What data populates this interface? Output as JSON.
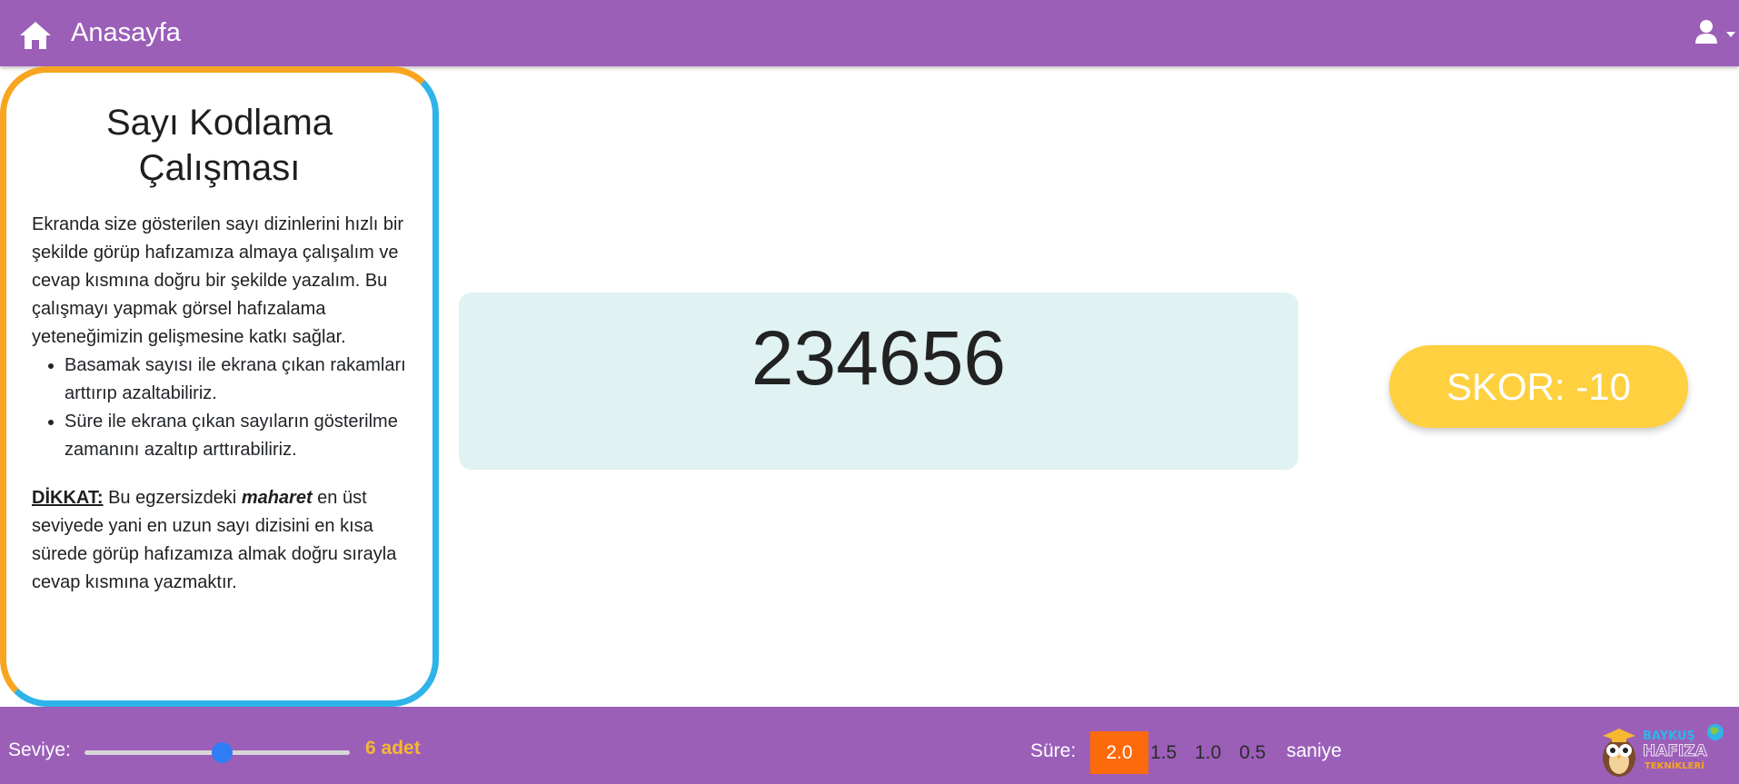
{
  "navbar": {
    "title": "Anasayfa",
    "home_icon": "home-icon",
    "user_icon": "user-icon",
    "background": "#9b5fb8"
  },
  "info": {
    "title_line1": "Sayı Kodlama",
    "title_line2": "Çalışması",
    "paragraph": "Ekranda size gösterilen sayı dizinlerini hızlı bir şekilde görüp hafızamıza almaya çalışalım ve cevap kısmına doğru bir şekilde yazalım. Bu çalışmayı yapmak görsel hafızalama yeteneğimizin gelişmesine katkı sağlar.",
    "bullets": [
      "Basamak sayısı ile ekrana çıkan rakamları arttırıp azaltabiliriz.",
      "Süre ile ekrana çıkan sayıların gösterilme zamanını azaltıp arttırabiliriz."
    ],
    "warning_label": "DİKKAT:",
    "warning_pre": " Bu egzersizdeki ",
    "warning_emph": "maharet",
    "warning_post": " en üst seviyede yani en uzun sayı dizisini en kısa sürede görüp hafızamıza almak doğru sırayla cevap kısmına yazmaktır."
  },
  "display": {
    "number": "234656"
  },
  "score": {
    "text": "SKOR: -10"
  },
  "controls": {
    "level_label": "Seviye:",
    "level_value": "6 adet",
    "level_fraction": 0.52,
    "time_label": "Süre:",
    "time_options": [
      "2.0",
      "1.5",
      "1.0",
      "0.5"
    ],
    "time_selected": "2.0",
    "time_unit": "saniye"
  },
  "brand": {
    "logo_line1": "BAYKUŞ",
    "logo_line2": "HAFIZA",
    "logo_line3": "TEKNİKLERİ"
  },
  "colors": {
    "accent_orange": "#f7a520",
    "accent_blue": "#2fb4e9",
    "score_yellow": "#ffd03f",
    "active_time": "#fd6a0c"
  }
}
